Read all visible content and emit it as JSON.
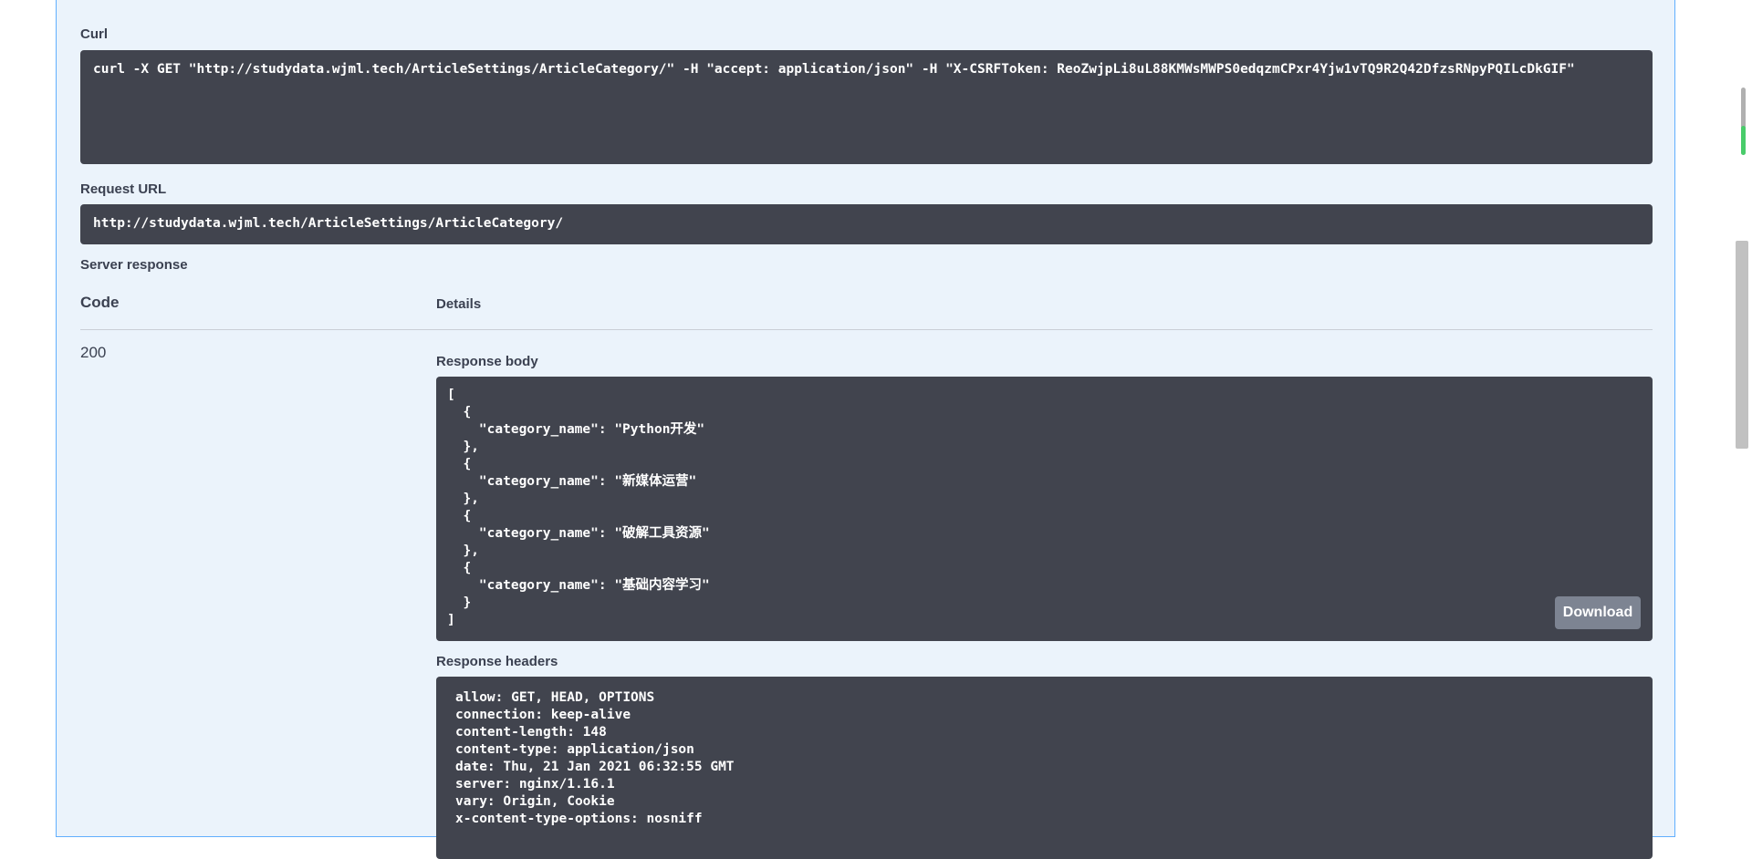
{
  "curl": {
    "label": "Curl",
    "command": "curl -X GET \"http://studydata.wjml.tech/ArticleSettings/ArticleCategory/\" -H \"accept: application/json\" -H \"X-CSRFToken: ReoZwjpLi8uL88KMWsMWPS0edqzmCPxr4Yjw1vTQ9R2Q42DfzsRNpyPQILcDkGIF\""
  },
  "request_url": {
    "label": "Request URL",
    "value": "http://studydata.wjml.tech/ArticleSettings/ArticleCategory/"
  },
  "server_response": {
    "label": "Server response",
    "columns": {
      "code": "Code",
      "details": "Details"
    },
    "code": "200",
    "response_body": {
      "label": "Response body",
      "text": "[\n  {\n    \"category_name\": \"Python开发\"\n  },\n  {\n    \"category_name\": \"新媒体运营\"\n  },\n  {\n    \"category_name\": \"破解工具资源\"\n  },\n  {\n    \"category_name\": \"基础内容学习\"\n  }\n]",
      "download_label": "Download"
    },
    "response_headers": {
      "label": "Response headers",
      "text": "allow: GET, HEAD, OPTIONS\nconnection: keep-alive\ncontent-length: 148\ncontent-type: application/json\ndate: Thu, 21 Jan 2021 06:32:55 GMT\nserver: nginx/1.16.1\nvary: Origin, Cookie\nx-content-type-options: nosniff"
    }
  }
}
